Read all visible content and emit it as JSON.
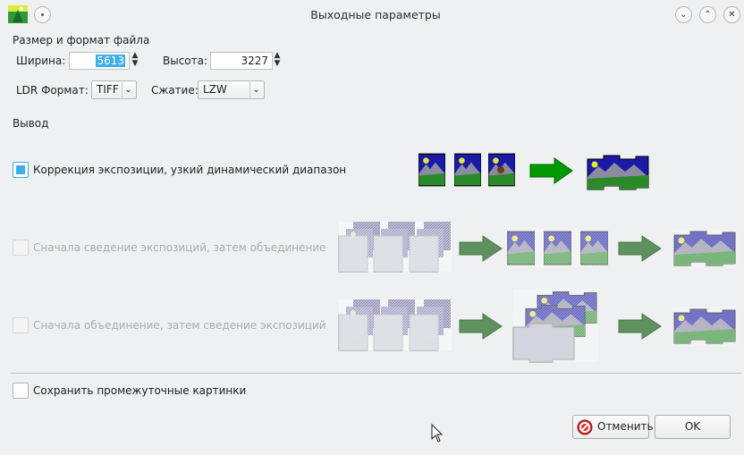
{
  "window": {
    "title": "Выходные параметры"
  },
  "size_format": {
    "heading": "Размер и формат файла",
    "width_label": "Ширина:",
    "width_value": "5613",
    "height_label": "Высота:",
    "height_value": "3227",
    "ldr_label": "LDR Формат:",
    "ldr_value": "TIFF",
    "compression_label": "Сжатие:",
    "compression_value": "LZW"
  },
  "output": {
    "heading": "Вывод",
    "options": [
      {
        "label": "Коррекция экспозиции, узкий динамический диапазон",
        "checked": true,
        "enabled": true
      },
      {
        "label": "Сначала сведение экспозиций, затем объединение",
        "checked": false,
        "enabled": false
      },
      {
        "label": "Сначала объединение, затем сведение экспозиций",
        "checked": false,
        "enabled": false
      }
    ]
  },
  "save_intermediate": {
    "label": "Сохранить промежуточные картинки",
    "checked": false
  },
  "buttons": {
    "cancel": "Отменить",
    "ok": "OK"
  },
  "colors": {
    "accent": "#3daee9",
    "arrow_green": "#009900",
    "sky": "#1a1aa6",
    "grass": "#2a8a2a"
  }
}
